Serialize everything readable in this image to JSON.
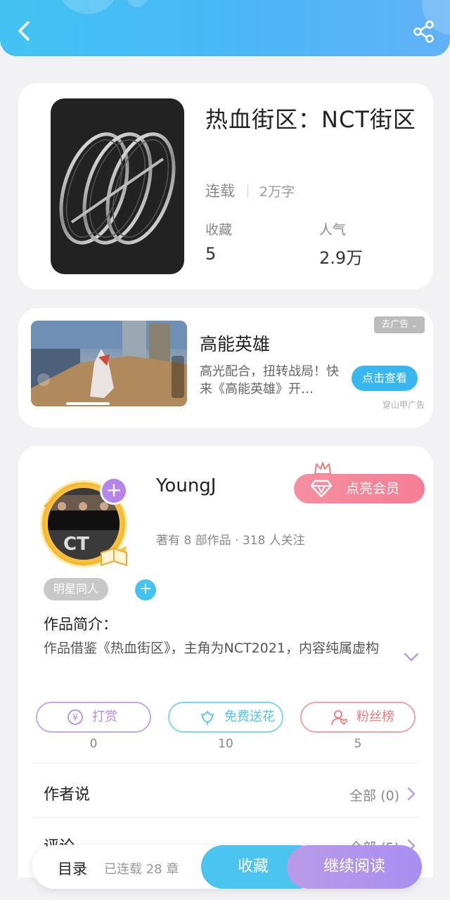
{
  "book": {
    "title": "热血街区：NCT街区",
    "status": "连载",
    "words": "2万字",
    "collect_label": "收藏",
    "collect_value": "5",
    "popularity_label": "人气",
    "popularity_value": "2.9万"
  },
  "ad": {
    "title": "高能英雄",
    "description": "高光配合，扭转战局！快来《高能英雄》开…",
    "remove_label": "去广告",
    "cta_label": "点击查看",
    "source": "穿山甲广告"
  },
  "author": {
    "name": "YoungJ",
    "meta": "著有 8 部作品 · 318 人关注",
    "vip_label": "点亮会员",
    "tag": "明星同人",
    "intro_heading": "作品简介：",
    "intro_text": "作品借鉴《热血街区》，主角为NCT2021，内容纯属虚构"
  },
  "actions": [
    {
      "label": "打赏",
      "count": "0",
      "color": "#b78be6"
    },
    {
      "label": "免费送花",
      "count": "10",
      "color": "#4cc4f0"
    },
    {
      "label": "粉丝榜",
      "count": "5",
      "color": "#f0797f"
    }
  ],
  "sections": {
    "author_says": {
      "title": "作者说",
      "right": "全部 (0)"
    },
    "comments": {
      "title": "评论",
      "right": "全部 (5)"
    }
  },
  "bottom_bar": {
    "toc": "目录",
    "chapters": "已连载 28 章",
    "favorite": "收藏",
    "continue_read": "继续阅读"
  },
  "colors": {
    "header_blue": "#4ab6f6",
    "accent_blue": "#4cc4f0",
    "accent_purple": "#b585ec",
    "vip_pink": "#f58fa2"
  }
}
